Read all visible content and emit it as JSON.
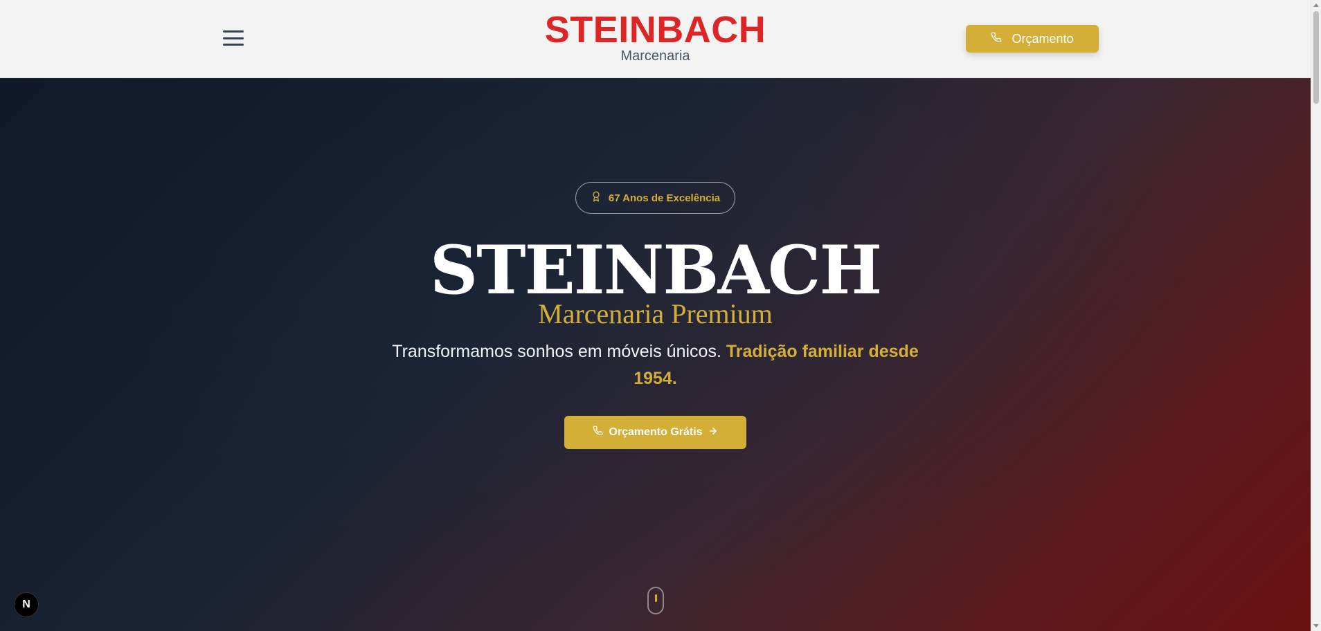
{
  "header": {
    "brand_name": "STEINBACH",
    "brand_subtitle": "Marcenaria",
    "quote_button_label": "Orçamento",
    "menu_icon": "hamburger-menu-icon",
    "phone_icon": "phone-icon"
  },
  "hero": {
    "badge_label": "67 Anos de Excelência",
    "badge_icon": "award-icon",
    "title": "STEINBACH",
    "subtitle": "Marcenaria Premium",
    "text_main": "Transformamos sonhos em móveis únicos.",
    "text_accent": "Tradição familiar desde 1954.",
    "cta_label": "Orçamento Grátis",
    "cta_icons": [
      "phone-icon",
      "arrow-right-icon"
    ],
    "scroll_icon": "mouse-scroll-icon"
  },
  "overlay": {
    "dev_badge_letter": "N"
  },
  "colors": {
    "brand_red": "#dc2626",
    "gold": "#d4af37",
    "dark_navy": "#111827",
    "deep_red": "#6b1111"
  }
}
